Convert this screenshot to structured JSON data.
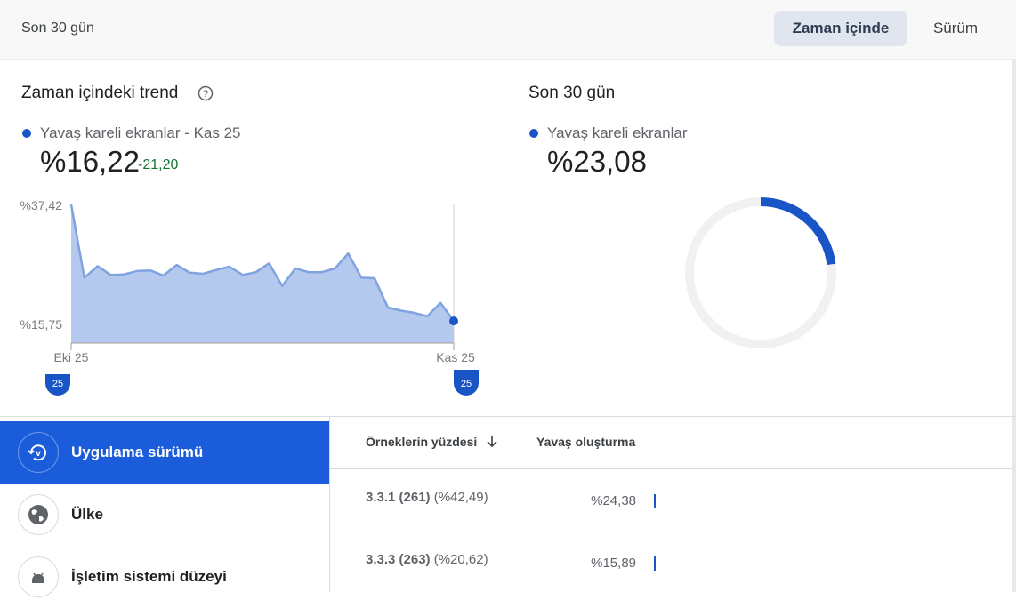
{
  "header": {
    "range_label": "Son 30 gün",
    "tabs": [
      {
        "label": "Zaman içinde",
        "active": true
      },
      {
        "label": "Sürüm",
        "active": false
      }
    ]
  },
  "trend": {
    "title": "Zaman içindeki trend",
    "legend_label": "Yavaş kareli ekranlar - Kas 25",
    "value": "%16,22",
    "delta": "-21,20",
    "y_top_label": "%37,42",
    "y_mid_label": "%15,75",
    "x_start_label": "Eki 25",
    "x_end_label": "Kas 25",
    "handle_start": "25",
    "handle_end": "25"
  },
  "summary": {
    "title": "Son 30 gün",
    "legend_label": "Yavaş kareli ekranlar",
    "value": "%23,08"
  },
  "chart_data": {
    "type": "area",
    "series": [
      {
        "values": [
          37.4,
          24.1,
          26.2,
          24.6,
          24.7,
          25.3,
          25.4,
          24.5,
          26.4,
          25.0,
          24.8,
          25.5,
          26.1,
          24.6,
          25.1,
          26.7,
          22.6,
          25.8,
          25.1,
          25.1,
          25.8,
          28.5,
          24.1,
          24.0,
          18.7,
          18.1,
          17.7,
          17.1,
          19.5,
          16.22
        ]
      }
    ],
    "ylim": [
      15.75,
      37.42
    ],
    "y_tick_labels": [
      "%37,42",
      "%15,75"
    ],
    "x_tick_labels": [
      "Eki 25",
      "Kas 25"
    ],
    "color": "#7fa3e0",
    "fill": "#b5c9ee"
  },
  "donut": {
    "fraction": 0.2308,
    "color": "#1a55c8",
    "track": "#f1f1f1"
  },
  "sidebar": {
    "items": [
      {
        "label": "Uygulama sürümü",
        "icon": "version-history-icon",
        "active": true
      },
      {
        "label": "Ülke",
        "icon": "globe-icon",
        "active": false
      },
      {
        "label": "İşletim sistemi düzeyi",
        "icon": "android-icon",
        "active": false
      }
    ]
  },
  "table": {
    "columns": [
      "Örneklerin yüzdesi",
      "Yavaş oluşturma"
    ],
    "rows": [
      {
        "version": "3.3.1 (261)",
        "pct": "(%42,49)",
        "value": "%24,38"
      },
      {
        "version": "3.3.3 (263)",
        "pct": "(%20,62)",
        "value": "%15,89"
      }
    ]
  },
  "colors": {
    "accent": "#1a5cd9",
    "positive": "#137333"
  }
}
